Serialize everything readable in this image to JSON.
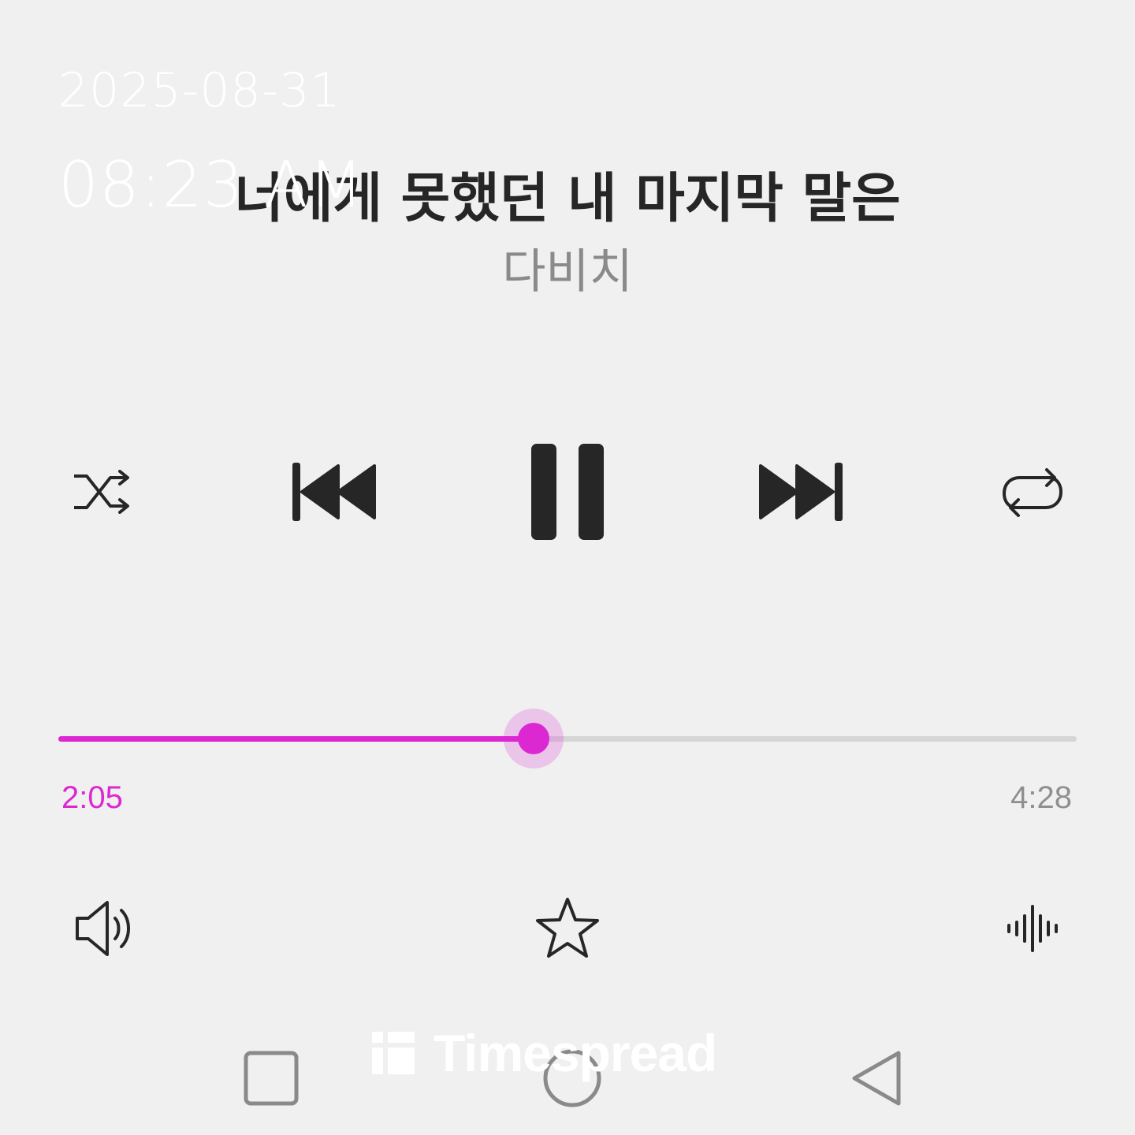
{
  "lockscreen": {
    "date": "2025-08-31",
    "time": "08:23 AM"
  },
  "track": {
    "title": "너에게 못했던 내 마지막 말은",
    "artist": "다비치"
  },
  "controls": {
    "shuffle_icon": "shuffle-icon",
    "previous_icon": "skip-previous-icon",
    "pause_icon": "pause-icon",
    "next_icon": "skip-next-icon",
    "repeat_icon": "repeat-icon"
  },
  "progress": {
    "elapsed": "2:05",
    "duration": "4:28",
    "fraction": 0.467
  },
  "bottom_actions": {
    "volume_icon": "volume-icon",
    "favorite_icon": "star-icon",
    "equalizer_icon": "sound-wave-icon"
  },
  "nav_bar": {
    "recents_icon": "recents-square-icon",
    "home_icon": "home-circle-icon",
    "back_icon": "back-triangle-icon"
  },
  "watermark": {
    "text": "Timespread"
  },
  "colors": {
    "background": "#f0f0f0",
    "accent": "#dc28d2",
    "icon": "#262626",
    "muted_text": "#8a8a8a",
    "track_bg": "#d6d6d6"
  }
}
